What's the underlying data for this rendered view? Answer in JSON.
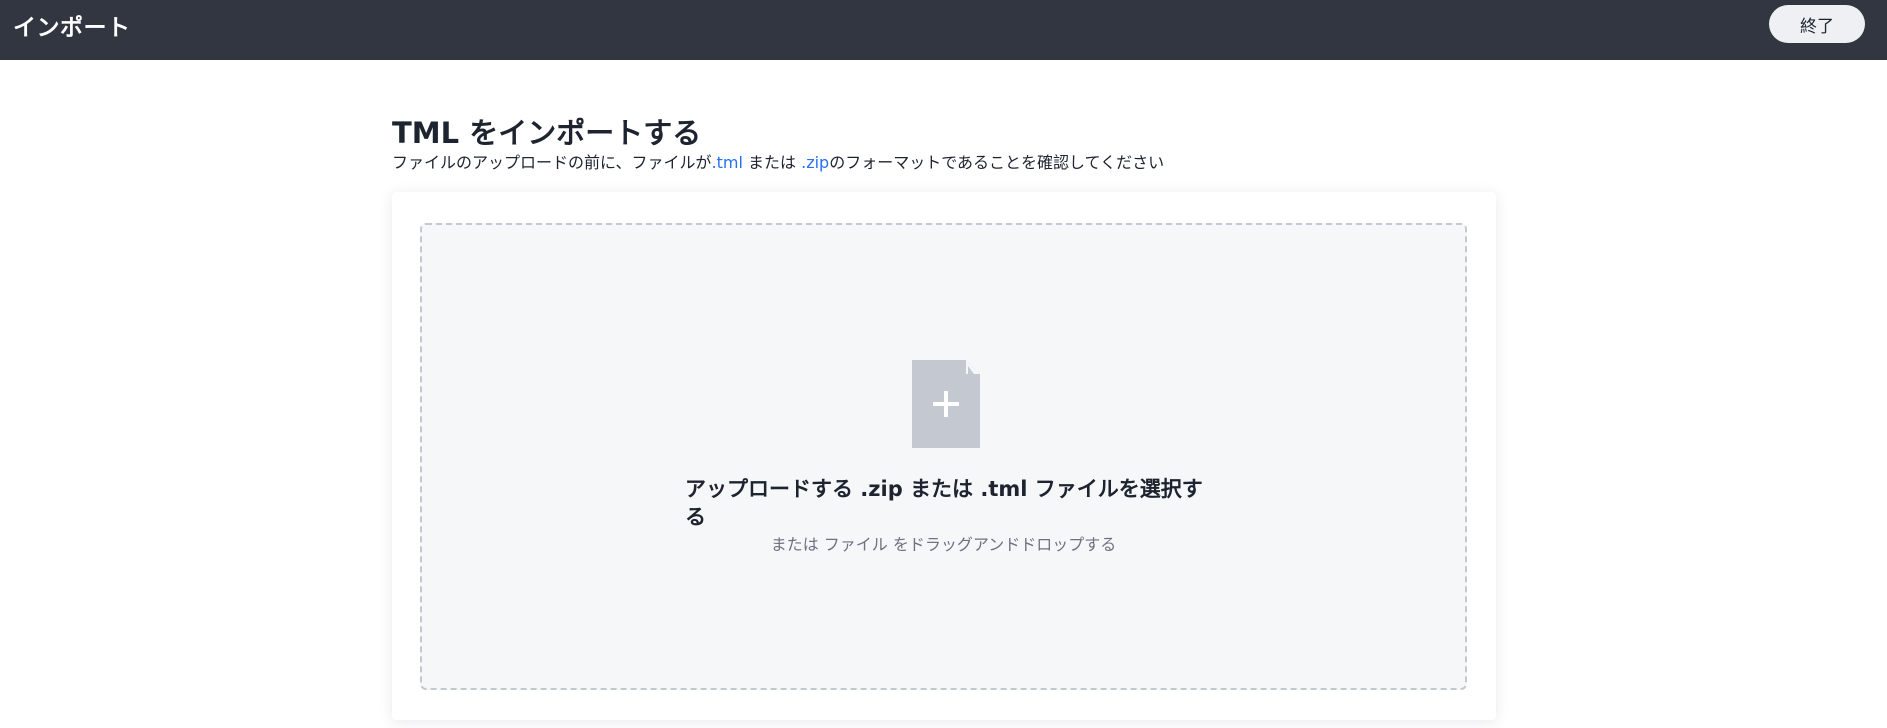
{
  "header": {
    "title": "インポート",
    "exit_label": "終了"
  },
  "main": {
    "title": "TML をインポートする",
    "subtitle_pre": "ファイルのアップロードの前に、ファイルが",
    "subtitle_ext1": ".tml",
    "subtitle_mid": " または ",
    "subtitle_ext2": ".zip",
    "subtitle_post": "のフォーマットであることを確認してください"
  },
  "dropzone": {
    "icon": "file-add-icon",
    "title": "アップロードする .zip または .tml ファイルを選択する",
    "hint": "または ファイル をドラッグアンドドロップする"
  },
  "colors": {
    "header_bg": "#323641",
    "link": "#2770ef",
    "dropzone_bg": "#f6f7f9",
    "icon": "#c3c8d1"
  }
}
